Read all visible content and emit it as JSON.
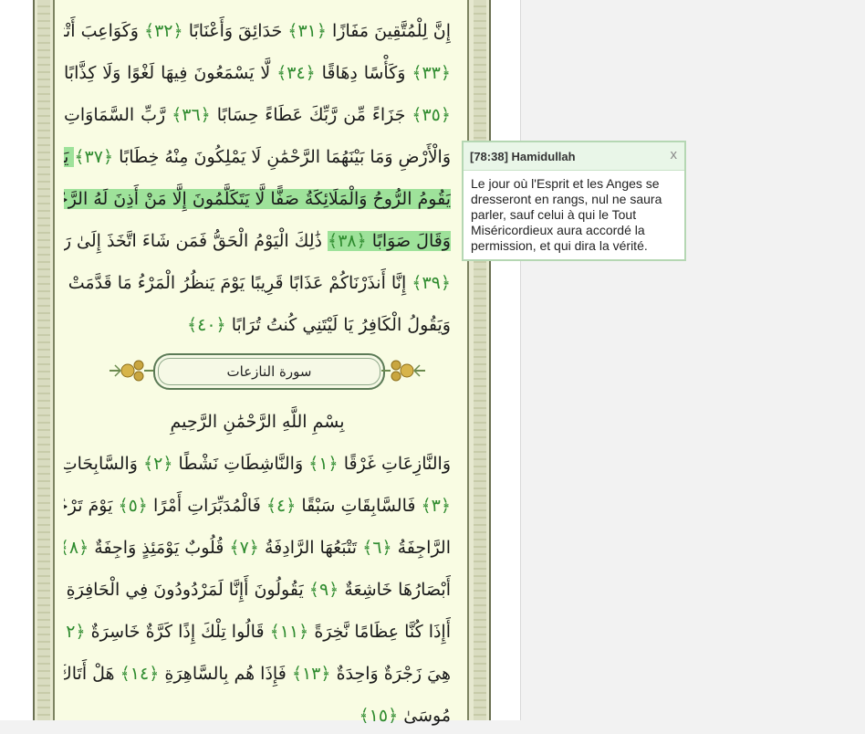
{
  "reader": {
    "lines": [
      {
        "segments": [
          {
            "text": "إِنَّ لِلْمُتَّقِينَ مَفَازًا ",
            "hl": false
          },
          {
            "text": "﴿٣١﴾",
            "num": true
          },
          {
            "text": " حَدَائِقَ وَأَعْنَابًا ",
            "hl": false
          },
          {
            "text": "﴿٣٢﴾",
            "num": true
          },
          {
            "text": " وَكَوَاعِبَ أَتْرَابًا",
            "hl": false
          }
        ]
      },
      {
        "segments": [
          {
            "text": "﴿٣٣﴾",
            "num": true
          },
          {
            "text": " وَكَأْسًا دِهَاقًا ",
            "hl": false
          },
          {
            "text": "﴿٣٤﴾",
            "num": true
          },
          {
            "text": " لَّا يَسْمَعُونَ فِيهَا لَغْوًا وَلَا كِذَّابًا",
            "hl": false
          }
        ]
      },
      {
        "segments": [
          {
            "text": "﴿٣٥﴾",
            "num": true
          },
          {
            "text": " جَزَاءً مِّن رَّبِّكَ عَطَاءً حِسَابًا ",
            "hl": false
          },
          {
            "text": "﴿٣٦﴾",
            "num": true
          },
          {
            "text": " رَّبِّ السَّمَاوَاتِ",
            "hl": false
          }
        ]
      },
      {
        "segments": [
          {
            "text": "وَالْأَرْضِ وَمَا بَيْنَهُمَا الرَّحْمَٰنِ لَا يَمْلِكُونَ مِنْهُ خِطَابًا ",
            "hl": false
          },
          {
            "text": "﴿٣٧﴾",
            "num": true
          },
          {
            "text": " يَوْمَ",
            "hl": true
          }
        ]
      },
      {
        "segments": [
          {
            "text": "يَقُومُ الرُّوحُ وَالْمَلَائِكَةُ صَفًّا لَّا يَتَكَلَّمُونَ إِلَّا مَنْ أَذِنَ لَهُ الرَّحْمَٰنُ",
            "hl": true
          }
        ]
      },
      {
        "segments": [
          {
            "text": "وَقَالَ صَوَابًا ",
            "hl": true
          },
          {
            "text": "﴿٣٨﴾",
            "num": true,
            "hl": true
          },
          {
            "text": " ذَٰلِكَ الْيَوْمُ الْحَقُّ فَمَن شَاءَ اتَّخَذَ إِلَىٰ رَبِّهِ مَآبًا",
            "hl": false
          }
        ]
      },
      {
        "segments": [
          {
            "text": "﴿٣٩﴾",
            "num": true
          },
          {
            "text": " إِنَّا أَنذَرْنَاكُمْ عَذَابًا قَرِيبًا يَوْمَ يَنظُرُ الْمَرْءُ مَا قَدَّمَتْ يَدَاهُ",
            "hl": false
          }
        ]
      },
      {
        "segments": [
          {
            "text": "وَيَقُولُ الْكَافِرُ يَا لَيْتَنِي كُنتُ تُرَابًا ",
            "hl": false
          },
          {
            "text": "﴿٤٠﴾",
            "num": true
          }
        ],
        "align": "last"
      },
      {
        "segments": [
          {
            "text": "بِسْمِ اللَّهِ الرَّحْمَٰنِ الرَّحِيمِ",
            "hl": false
          }
        ],
        "align": "center"
      },
      {
        "segments": [
          {
            "text": "وَالنَّازِعَاتِ غَرْقًا ",
            "hl": false
          },
          {
            "text": "﴿١﴾",
            "num": true
          },
          {
            "text": " وَالنَّاشِطَاتِ نَشْطًا ",
            "hl": false
          },
          {
            "text": "﴿٢﴾",
            "num": true
          },
          {
            "text": " وَالسَّابِحَاتِ سَبْحًا",
            "hl": false
          }
        ]
      },
      {
        "segments": [
          {
            "text": "﴿٣﴾",
            "num": true
          },
          {
            "text": " فَالسَّابِقَاتِ سَبْقًا ",
            "hl": false
          },
          {
            "text": "﴿٤﴾",
            "num": true
          },
          {
            "text": " فَالْمُدَبِّرَاتِ أَمْرًا ",
            "hl": false
          },
          {
            "text": "﴿٥﴾",
            "num": true
          },
          {
            "text": " يَوْمَ تَرْجُفُ",
            "hl": false
          }
        ]
      },
      {
        "segments": [
          {
            "text": "الرَّاجِفَةُ ",
            "hl": false
          },
          {
            "text": "﴿٦﴾",
            "num": true
          },
          {
            "text": " تَتْبَعُهَا الرَّادِفَةُ ",
            "hl": false
          },
          {
            "text": "﴿٧﴾",
            "num": true
          },
          {
            "text": " قُلُوبٌ يَوْمَئِذٍ وَاجِفَةٌ ",
            "hl": false
          },
          {
            "text": "﴿٨﴾",
            "num": true
          }
        ]
      },
      {
        "segments": [
          {
            "text": "أَبْصَارُهَا خَاشِعَةٌ ",
            "hl": false
          },
          {
            "text": "﴿٩﴾",
            "num": true
          },
          {
            "text": " يَقُولُونَ أَإِنَّا لَمَرْدُودُونَ فِي الْحَافِرَةِ ",
            "hl": false
          },
          {
            "text": "﴿١٠﴾",
            "num": true
          }
        ]
      },
      {
        "segments": [
          {
            "text": "أَإِذَا كُنَّا عِظَامًا نَّخِرَةً ",
            "hl": false
          },
          {
            "text": "﴿١١﴾",
            "num": true
          },
          {
            "text": " قَالُوا تِلْكَ إِذًا كَرَّةٌ خَاسِرَةٌ ",
            "hl": false
          },
          {
            "text": "﴿١٢﴾",
            "num": true
          },
          {
            "text": " فَإِنَّمَا",
            "hl": false
          }
        ]
      },
      {
        "segments": [
          {
            "text": "هِيَ زَجْرَةٌ وَاحِدَةٌ ",
            "hl": false
          },
          {
            "text": "﴿١٣﴾",
            "num": true
          },
          {
            "text": " فَإِذَا هُم بِالسَّاهِرَةِ ",
            "hl": false
          },
          {
            "text": "﴿١٤﴾",
            "num": true
          },
          {
            "text": " هَلْ أَتَاكَ حَدِيثُ",
            "hl": false
          }
        ]
      },
      {
        "segments": [
          {
            "text": "مُوسَىٰ ",
            "hl": false
          },
          {
            "text": "﴿١٥﴾",
            "num": true
          }
        ],
        "align": "last"
      }
    ],
    "surah_banner_title": "سورة النازعات"
  },
  "popup": {
    "title": "[78:38] Hamidullah",
    "close": "x",
    "text": "Le jour où l'Esprit et les Anges se dresseront en rangs, nul ne saura parler, sauf celui à qui le Tout Miséricordieux aura accordé la permission, et qui dira la vérité."
  },
  "colors": {
    "highlight": "#9ee29a",
    "verse_marker": "#2e8b2e",
    "page_bg": "#f9fce3"
  }
}
